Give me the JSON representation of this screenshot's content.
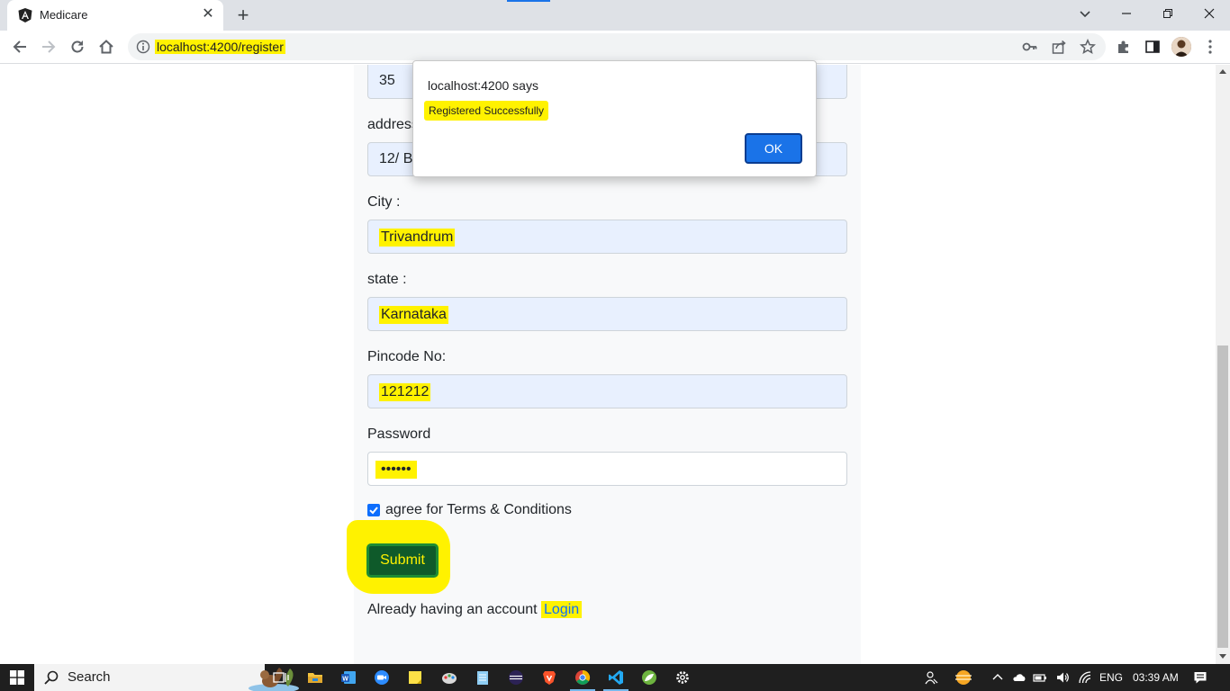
{
  "browser": {
    "tab_title": "Medicare",
    "url": "localhost:4200/register"
  },
  "form": {
    "age_value": "35",
    "address_label": "address",
    "address_value": "12/ B",
    "city_label": "City :",
    "city_value": "Trivandrum",
    "state_label": "state :",
    "state_value": "Karnataka",
    "pincode_label": "Pincode No:",
    "pincode_value": "121212",
    "password_label": "Password",
    "password_value": "••••••",
    "terms_label": "agree for Terms & Conditions",
    "terms_checked": true,
    "submit_label": "Submit",
    "account_text": "Already having an account",
    "login_link": "Login"
  },
  "dialog": {
    "title": "localhost:4200 says",
    "message": "Registered Successfully",
    "ok_label": "OK"
  },
  "taskbar": {
    "search_label": "Search",
    "language": "ENG",
    "time": "03:39 AM"
  },
  "colors": {
    "highlight": "#fff200",
    "accent": "#1a73e8",
    "submit_bg": "#0f5a2a"
  }
}
